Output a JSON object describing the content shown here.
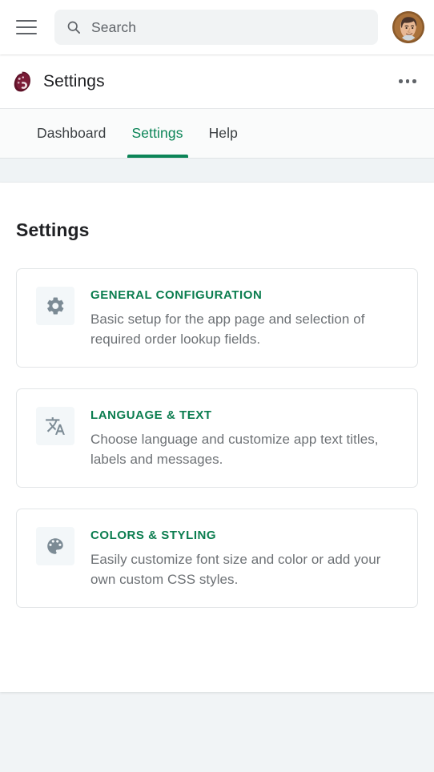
{
  "topbar": {
    "menu_icon": "hamburger-menu-icon",
    "search": {
      "icon": "search-icon",
      "placeholder": "Search",
      "value": ""
    },
    "avatar": "user-avatar"
  },
  "approw": {
    "app_icon": "app-logo-icon",
    "title": "Settings",
    "overflow_icon": "more-options-icon"
  },
  "tabs": {
    "items": [
      {
        "label": "Dashboard",
        "active": false
      },
      {
        "label": "Settings",
        "active": true
      },
      {
        "label": "Help",
        "active": false
      }
    ]
  },
  "main": {
    "page_title": "Settings",
    "cards": [
      {
        "icon": "gear-icon",
        "title": "GENERAL CONFIGURATION",
        "description": "Basic setup for the app page and selection of required order lookup fields."
      },
      {
        "icon": "translate-icon",
        "title": "LANGUAGE & TEXT",
        "description": "Choose language and customize app text titles, labels and messages."
      },
      {
        "icon": "palette-icon",
        "title": "COLORS & STYLING",
        "description": "Easily customize font size and color or add your own custom CSS styles."
      }
    ]
  },
  "colors": {
    "accent_green": "#0b8457",
    "card_title_green": "#0b7d4f",
    "body_text_gray": "#6d7175",
    "icon_gray": "#7c8b95",
    "page_background": "#f1f4f6",
    "band_background": "#eff3f5",
    "search_field": "#f1f3f4"
  }
}
